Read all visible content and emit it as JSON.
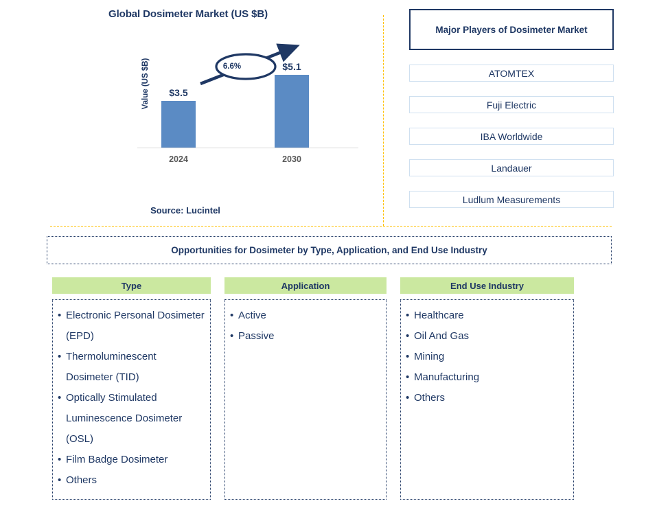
{
  "chart_panel": {
    "title": "Global Dosimeter Market (US $B)",
    "y_axis_label": "Value (US $B)",
    "source": "Source: Lucintel"
  },
  "chart_data": {
    "type": "bar",
    "title": "Global Dosimeter Market (US $B)",
    "categories": [
      "2024",
      "2030"
    ],
    "values": [
      3.5,
      5.1
    ],
    "value_labels": [
      "$3.5",
      "$5.1"
    ],
    "xlabel": "",
    "ylabel": "Value (US $B)",
    "ylim": [
      0,
      6
    ],
    "grid": false,
    "legend": "none",
    "bar_color": "#5b8bc4",
    "annotations": [
      {
        "text": "6.6%",
        "type": "cagr-arrow-ellipse",
        "description": "Upward arrow through ellipse between 2024 and 2030 bars"
      }
    ]
  },
  "players": {
    "header": "Major Players of Dosimeter Market",
    "items": [
      "ATOMTEX",
      "Fuji Electric",
      "IBA Worldwide",
      "Landauer",
      "Ludlum Measurements"
    ]
  },
  "opportunities": {
    "banner": "Opportunities for Dosimeter by Type, Application, and End Use Industry"
  },
  "segments": [
    {
      "header": "Type",
      "items": [
        "Electronic Personal Dosimeter (EPD)",
        "Thermoluminescent Dosimeter (TID)",
        "Optically Stimulated Luminescence Dosimeter (OSL)",
        "Film Badge Dosimeter",
        "Others"
      ]
    },
    {
      "header": "Application",
      "items": [
        "Active",
        "Passive"
      ]
    },
    {
      "header": "End Use Industry",
      "items": [
        "Healthcare",
        "Oil And Gas",
        "Mining",
        "Manufacturing",
        "Others"
      ]
    }
  ],
  "colors": {
    "navy": "#1f3864",
    "bar_blue": "#5b8bc4",
    "header_green": "#cbe8a0",
    "divider_orange": "#ffc000",
    "player_border": "#cfe0f0"
  }
}
